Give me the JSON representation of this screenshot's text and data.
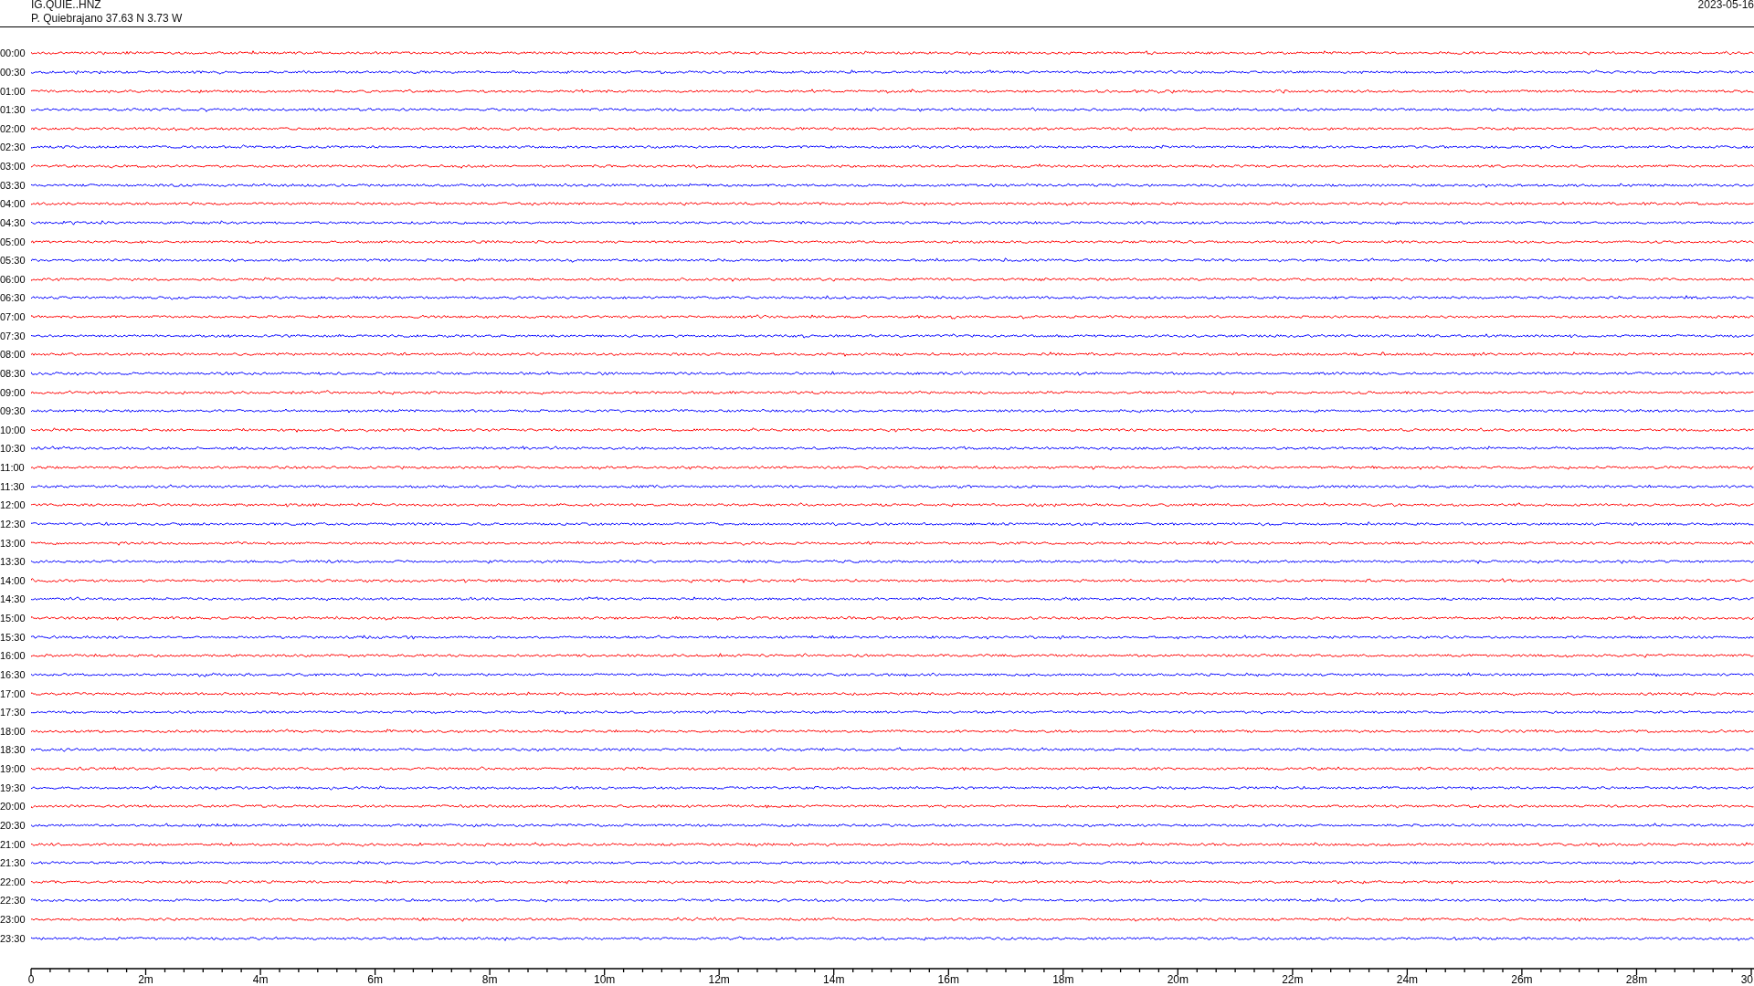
{
  "header": {
    "station_code": "IG.QUIE..HNZ",
    "station_info": "P. Quiebrajano  37.63 N 3.73 W",
    "date": "2023-05-16"
  },
  "traces": [
    {
      "label": "00:00",
      "color": "#ff0000"
    },
    {
      "label": "00:30",
      "color": "#0000ff"
    },
    {
      "label": "01:00",
      "color": "#ff0000"
    },
    {
      "label": "01:30",
      "color": "#0000ff"
    },
    {
      "label": "02:00",
      "color": "#ff0000"
    },
    {
      "label": "02:30",
      "color": "#0000ff"
    },
    {
      "label": "03:00",
      "color": "#ff0000"
    },
    {
      "label": "03:30",
      "color": "#0000ff"
    },
    {
      "label": "04:00",
      "color": "#ff0000"
    },
    {
      "label": "04:30",
      "color": "#0000ff"
    },
    {
      "label": "05:00",
      "color": "#ff0000"
    },
    {
      "label": "05:30",
      "color": "#0000ff"
    },
    {
      "label": "06:00",
      "color": "#ff0000"
    },
    {
      "label": "06:30",
      "color": "#0000ff"
    },
    {
      "label": "07:00",
      "color": "#ff0000"
    },
    {
      "label": "07:30",
      "color": "#0000ff"
    },
    {
      "label": "08:00",
      "color": "#ff0000"
    },
    {
      "label": "08:30",
      "color": "#0000ff"
    },
    {
      "label": "09:00",
      "color": "#ff0000"
    },
    {
      "label": "09:30",
      "color": "#0000ff"
    },
    {
      "label": "10:00",
      "color": "#ff0000"
    },
    {
      "label": "10:30",
      "color": "#0000ff"
    },
    {
      "label": "11:00",
      "color": "#ff0000"
    },
    {
      "label": "11:30",
      "color": "#0000ff"
    },
    {
      "label": "12:00",
      "color": "#ff0000"
    },
    {
      "label": "12:30",
      "color": "#0000ff"
    },
    {
      "label": "13:00",
      "color": "#ff0000"
    },
    {
      "label": "13:30",
      "color": "#0000ff"
    },
    {
      "label": "14:00",
      "color": "#ff0000"
    },
    {
      "label": "14:30",
      "color": "#0000ff"
    },
    {
      "label": "15:00",
      "color": "#ff0000"
    },
    {
      "label": "15:30",
      "color": "#0000ff"
    },
    {
      "label": "16:00",
      "color": "#ff0000"
    },
    {
      "label": "16:30",
      "color": "#0000ff"
    },
    {
      "label": "17:00",
      "color": "#ff0000"
    },
    {
      "label": "17:30",
      "color": "#0000ff"
    },
    {
      "label": "18:00",
      "color": "#ff0000"
    },
    {
      "label": "18:30",
      "color": "#0000ff"
    },
    {
      "label": "19:00",
      "color": "#ff0000"
    },
    {
      "label": "19:30",
      "color": "#0000ff"
    },
    {
      "label": "20:00",
      "color": "#ff0000"
    },
    {
      "label": "20:30",
      "color": "#0000ff"
    },
    {
      "label": "21:00",
      "color": "#ff0000"
    },
    {
      "label": "21:30",
      "color": "#0000ff"
    },
    {
      "label": "22:00",
      "color": "#ff0000"
    },
    {
      "label": "22:30",
      "color": "#0000ff"
    },
    {
      "label": "23:00",
      "color": "#ff0000"
    },
    {
      "label": "23:30",
      "color": "#0000ff"
    }
  ],
  "time_axis": {
    "labels": [
      "0",
      "2m",
      "4m",
      "6m",
      "8m",
      "10m",
      "12m",
      "14m",
      "16m",
      "18m",
      "20m",
      "22m",
      "24m",
      "26m",
      "28m",
      "30"
    ]
  }
}
